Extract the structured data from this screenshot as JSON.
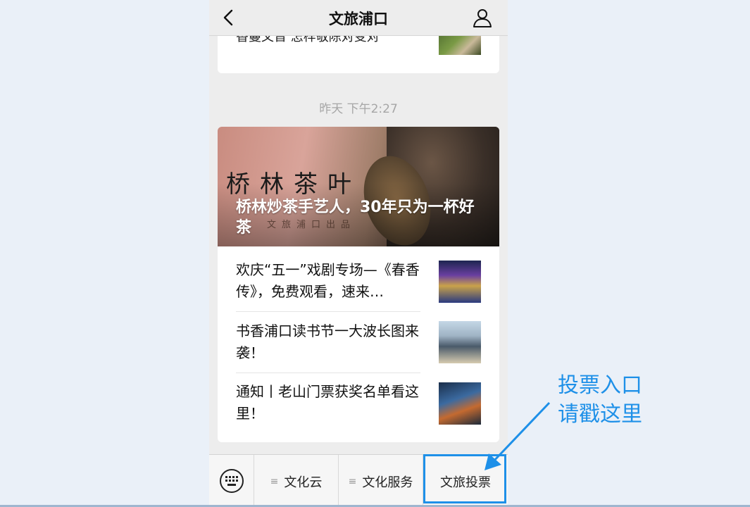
{
  "navbar": {
    "title": "文旅浦口"
  },
  "prev_article": {
    "title": "香蔓文晋 怎样敬陈对变对"
  },
  "timestamp": "昨天 下午2:27",
  "article_card": {
    "cover": {
      "calligraphy": "桥林茶叶",
      "subbrand": "文旅浦口出品",
      "title": "桥林炒茶手艺人，30年只为一杯好茶"
    },
    "items": [
      {
        "title": "欢庆“五一”戏剧专场—《春香传》，免费观看，速来…"
      },
      {
        "title": "书香浦口读书节一大波长图来袭！"
      },
      {
        "title": "通知丨老山门票获奖名单看这里！"
      }
    ]
  },
  "menu": {
    "items": [
      {
        "label": "文化云",
        "glyph": "≡"
      },
      {
        "label": "文化服务",
        "glyph": "≡"
      },
      {
        "label": "文旅投票"
      }
    ]
  },
  "annotation": {
    "line1": "投票入口",
    "line2": "请戳这里",
    "color": "#1e90e8"
  }
}
